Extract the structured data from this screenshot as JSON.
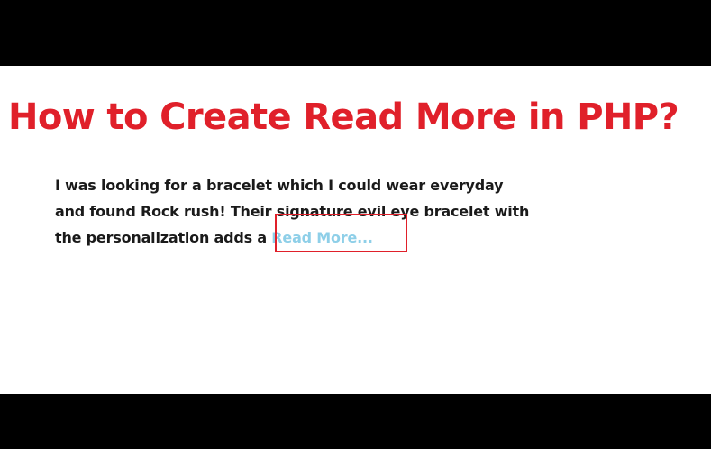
{
  "title": {
    "text": "How to Create Read More in PHP?",
    "color": "#e0202a"
  },
  "content": {
    "lines": [
      "I was looking for a bracelet which I could wear everyday",
      "and found Rock rush! Their signature evil eye bracelet with",
      "the personalization adds a "
    ],
    "read_more_label": "Read More...",
    "read_more_color": "#8ecfe8",
    "highlight_color": "#e0202a"
  },
  "colors": {
    "background": "#ffffff",
    "letterbox": "#000000",
    "text": "#1a1a1a"
  }
}
